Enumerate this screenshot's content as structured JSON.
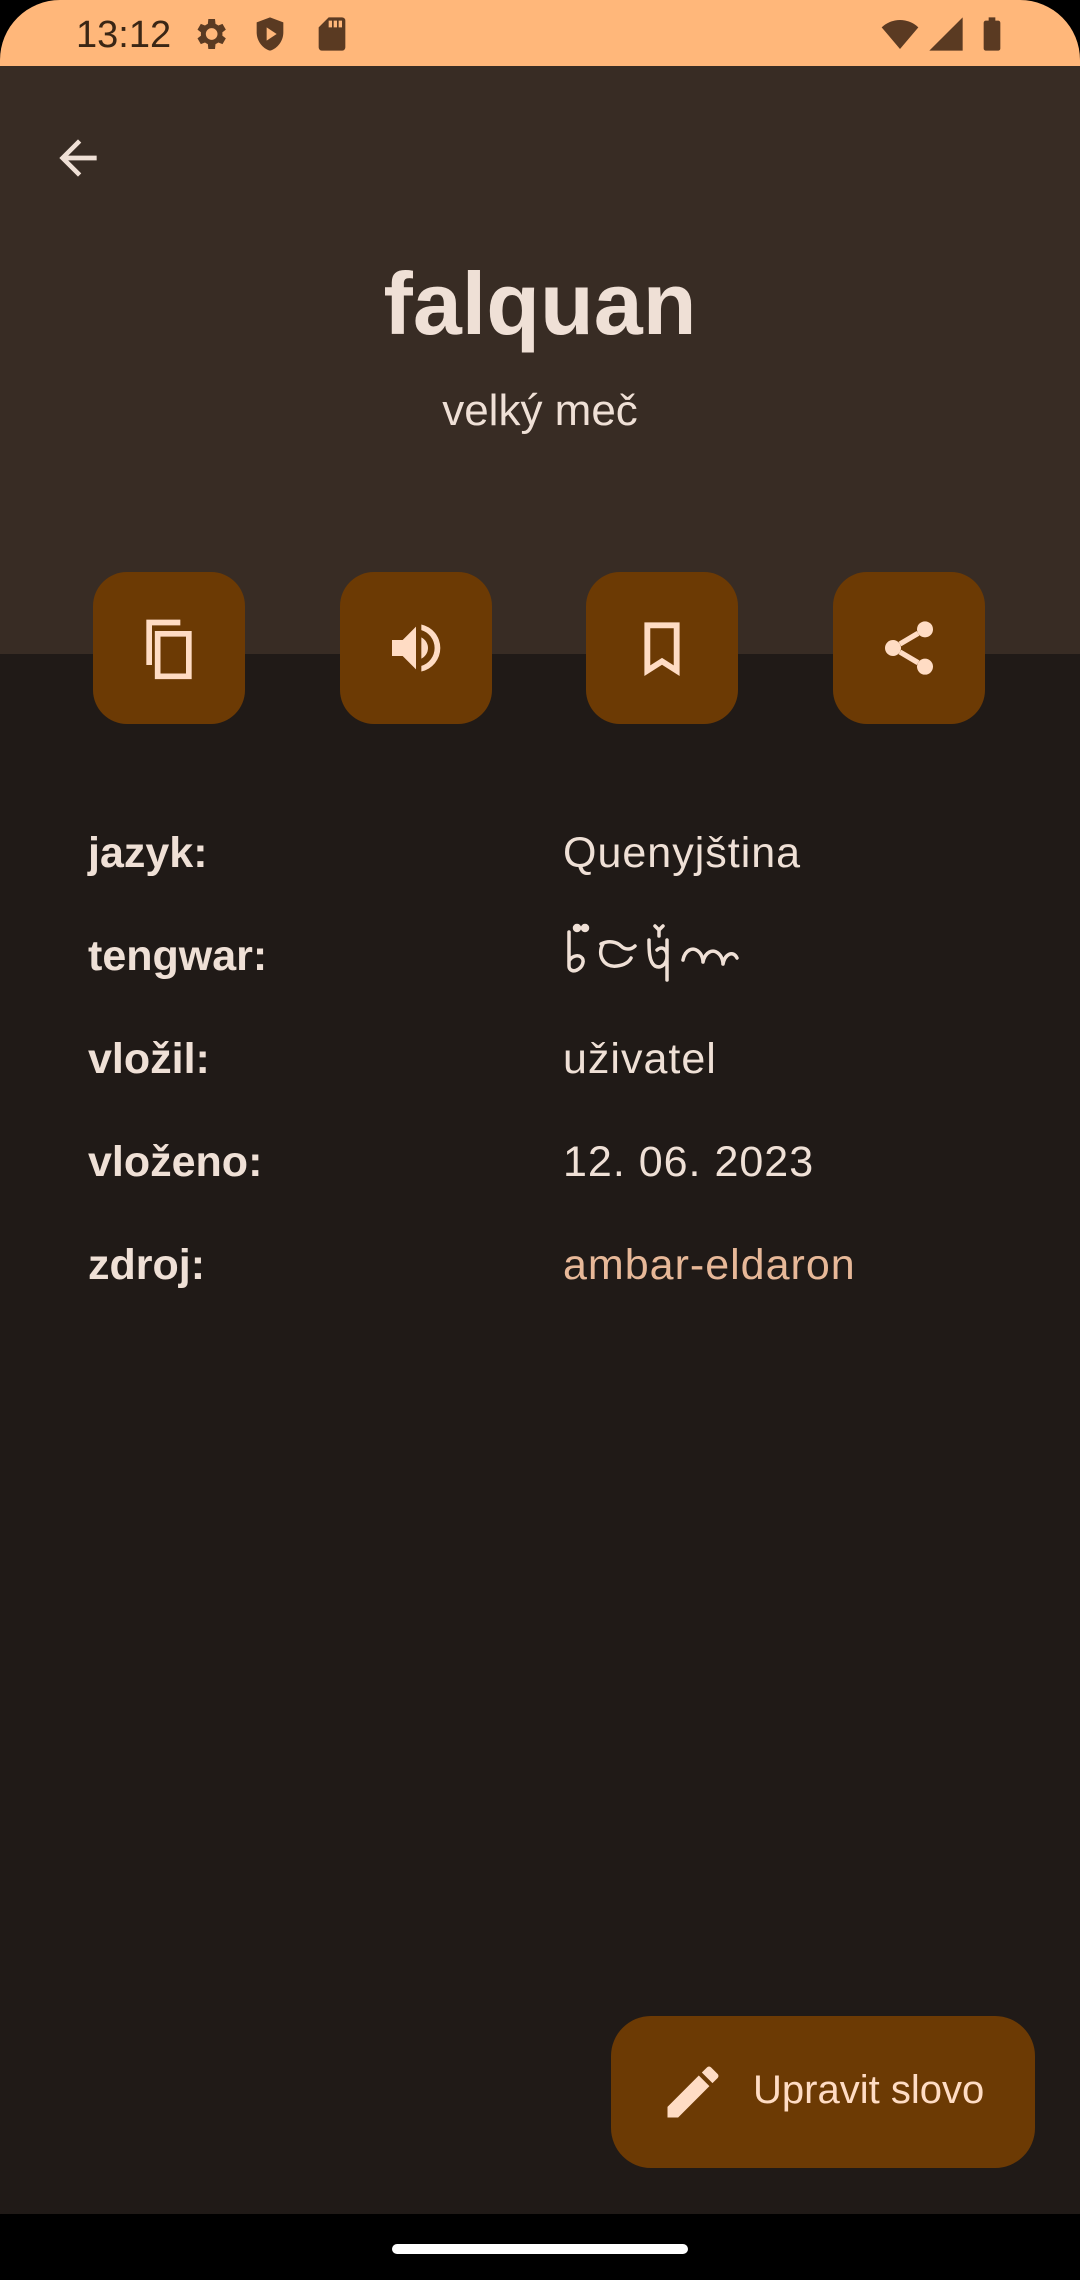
{
  "status_bar": {
    "time": "13:12",
    "left_icons": [
      "gear-icon",
      "shield-play-icon",
      "sd-card-icon"
    ],
    "right_icons": [
      "wifi-icon",
      "cellular-signal-icon",
      "battery-icon"
    ]
  },
  "header": {
    "back_icon": "arrow-back-icon",
    "word": "falquan",
    "translation": "velký meč"
  },
  "actions": [
    {
      "name": "copy",
      "icon": "copy-icon"
    },
    {
      "name": "speak",
      "icon": "volume-icon"
    },
    {
      "name": "bookmark",
      "icon": "bookmark-icon"
    },
    {
      "name": "share",
      "icon": "share-icon"
    }
  ],
  "details": {
    "language_label": "jazyk:",
    "language_value": "Quenyjština",
    "tengwar_label": "tengwar:",
    "tengwar_value": "",
    "added_by_label": "vložil:",
    "added_by_value": "uživatel",
    "added_on_label": "vloženo:",
    "added_on_value": "12. 06. 2023",
    "source_label": "zdroj:",
    "source_value": "ambar-eldaron"
  },
  "fab": {
    "icon": "pencil-icon",
    "label": "Upravit slovo"
  },
  "colors": {
    "status_bar": "#ffb77a",
    "header_bg": "#382c24",
    "body_bg": "#201a17",
    "button_bg": "#6c3a04",
    "accent_link": "#e7b898",
    "text": "#efe0d6"
  }
}
